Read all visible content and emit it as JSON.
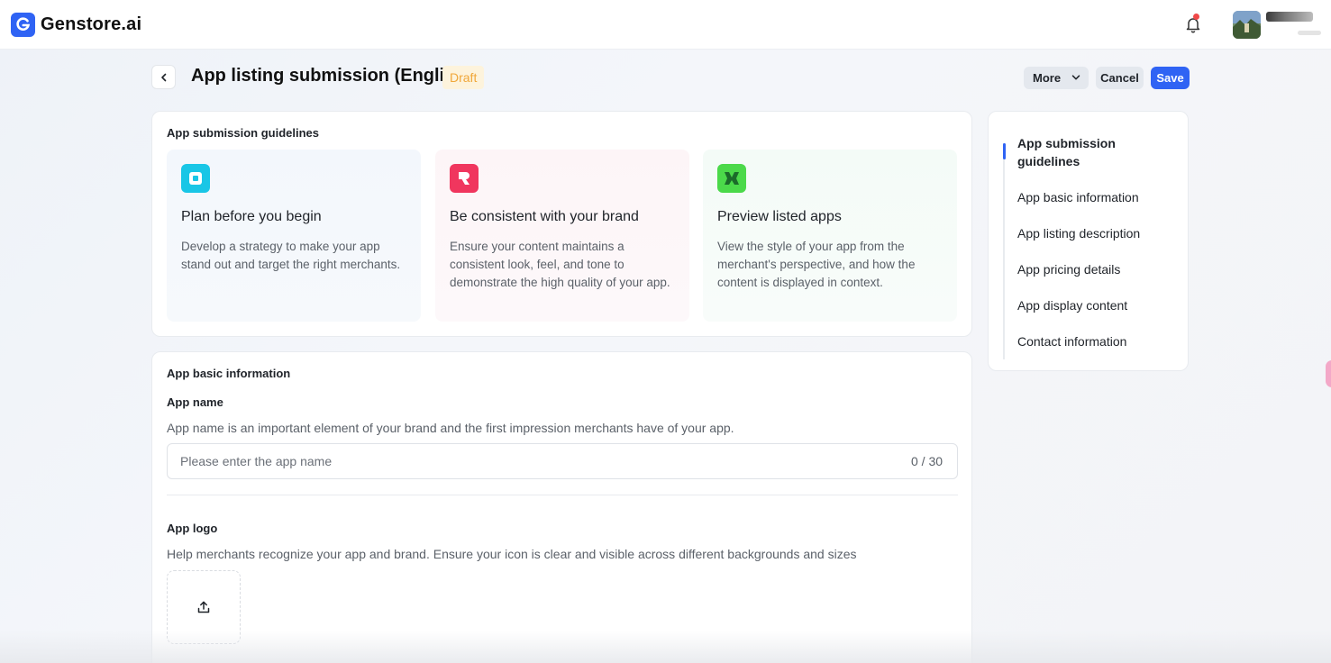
{
  "topbar": {
    "brand_name": "Genstore.ai",
    "user_name": "",
    "notification_dot": true
  },
  "header": {
    "title": "App listing submission (English)",
    "status_badge": "Draft",
    "more_label": "More",
    "cancel_label": "Cancel",
    "save_label": "Save"
  },
  "guidelines": {
    "title": "App submission guidelines",
    "items": [
      {
        "title": "Plan before you begin",
        "desc": "Develop a strategy to make your app stand out and target the right merchants.",
        "icon": "plan-icon",
        "color": "#19c6e6"
      },
      {
        "title": "Be consistent with your brand",
        "desc": "Ensure your content maintains a consistent look, feel, and tone to demonstrate the high quality of your app.",
        "icon": "brand-icon",
        "color": "#f0365e"
      },
      {
        "title": "Preview listed apps",
        "desc": "View the style of your app from the merchant's perspective, and how the content is displayed in context.",
        "icon": "preview-icon",
        "color": "#4bd94a"
      }
    ]
  },
  "basic_info": {
    "title": "App basic information",
    "app_name": {
      "label": "App name",
      "help": "App name is an important element of your brand and the first impression merchants have of your app.",
      "placeholder": "Please enter the app name",
      "value": "",
      "counter": "0 / 30"
    },
    "app_logo": {
      "label": "App logo",
      "help": "Help merchants recognize your app and brand. Ensure your icon is clear and visible across different backgrounds and sizes"
    }
  },
  "toc": {
    "items": [
      {
        "label": "App submission guidelines",
        "active": true
      },
      {
        "label": "App basic information",
        "active": false
      },
      {
        "label": "App listing description",
        "active": false
      },
      {
        "label": "App pricing details",
        "active": false
      },
      {
        "label": "App display content",
        "active": false
      },
      {
        "label": "Contact information",
        "active": false
      }
    ]
  },
  "colors": {
    "accent": "#2f63f4",
    "draft": "#f0a73a"
  }
}
